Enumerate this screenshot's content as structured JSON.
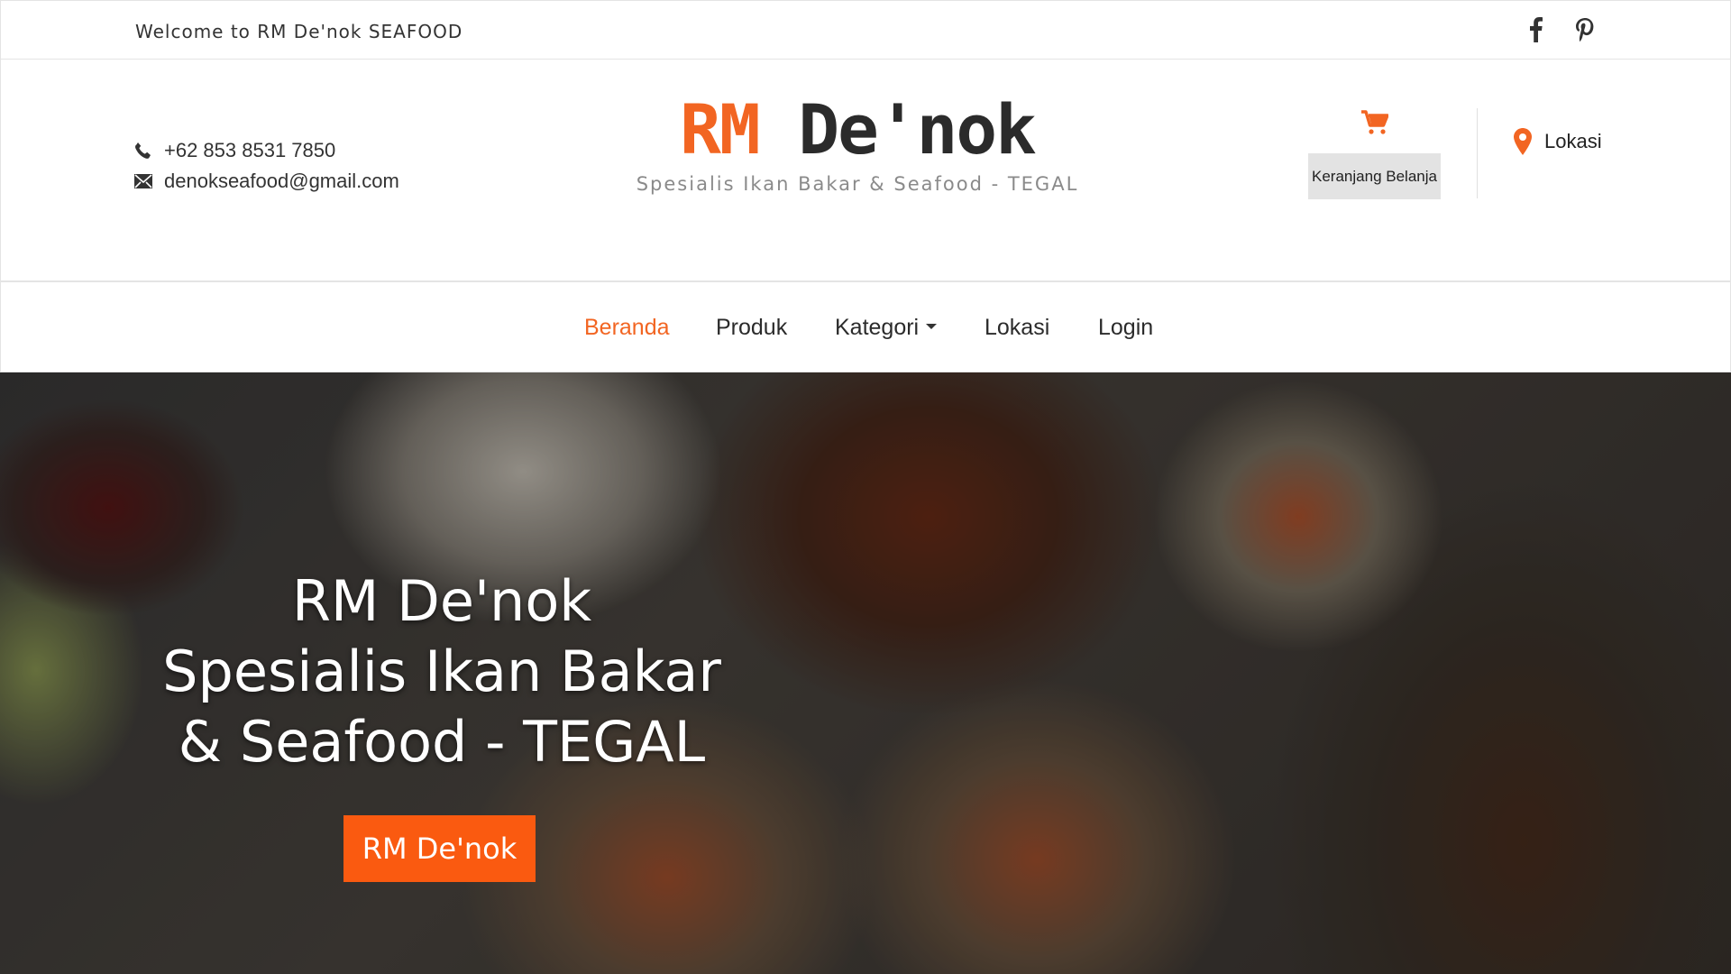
{
  "topbar": {
    "welcome": "Welcome to RM De'nok SEAFOOD",
    "social": [
      "facebook-icon",
      "pinterest-icon"
    ]
  },
  "header": {
    "phone": "+62 853 8531 7850",
    "email": "denokseafood@gmail.com",
    "brand_rm": "RM",
    "brand_name": "De'nok",
    "tagline": "Spesialis Ikan Bakar & Seafood - TEGAL",
    "cart_label": "Keranjang Belanja",
    "location_label": "Lokasi"
  },
  "nav": {
    "items": [
      {
        "label": "Beranda",
        "active": true
      },
      {
        "label": "Produk"
      },
      {
        "label": "Kategori"
      },
      {
        "label": "Lokasi"
      },
      {
        "label": "Login"
      }
    ]
  },
  "hero": {
    "line1": "RM De'nok",
    "line2": "Spesialis Ikan Bakar",
    "line3": "& Seafood - TEGAL",
    "button": "RM De'nok"
  },
  "colors": {
    "accent": "#f26522",
    "button": "#fa5a10",
    "text": "#2b2b2b"
  }
}
